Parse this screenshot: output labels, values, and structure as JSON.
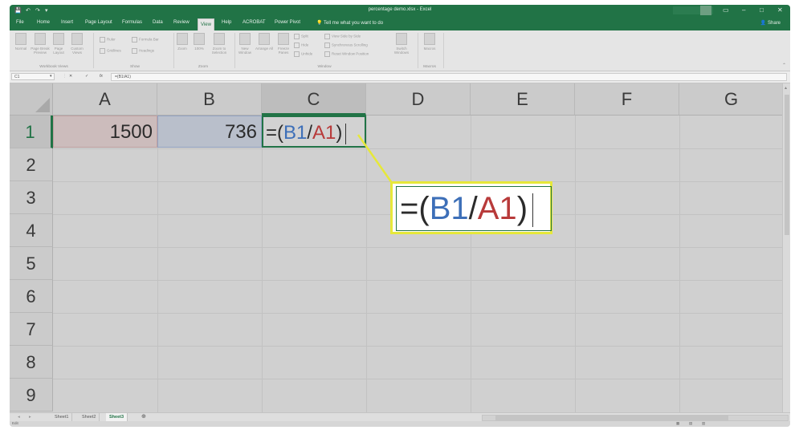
{
  "titlebar": {
    "doc_title": "percentage demo.xlsx - Excel",
    "minimize": "–",
    "restore": "□",
    "close": "✕",
    "quick_access": [
      "💾",
      "↶",
      "↷",
      "▾"
    ]
  },
  "tabs": {
    "items": [
      "File",
      "Home",
      "Insert",
      "Page Layout",
      "Formulas",
      "Data",
      "Review",
      "View",
      "Help",
      "ACROBAT",
      "Power Pivot"
    ],
    "active": "View",
    "tell_me": "Tell me what you want to do",
    "share": "Share"
  },
  "ribbon": {
    "groups": [
      {
        "label": "Workbook Views",
        "buttons": [
          "Normal",
          "Page Break Preview",
          "Page Layout",
          "Custom Views"
        ]
      },
      {
        "label": "Show",
        "checks": [
          "Ruler",
          "Formula Bar",
          "Gridlines",
          "Headings"
        ]
      },
      {
        "label": "Zoom",
        "buttons": [
          "Zoom",
          "100%",
          "Zoom to Selection"
        ]
      },
      {
        "label": "Window",
        "buttons": [
          "New Window",
          "Arrange All",
          "Freeze Panes"
        ],
        "small": [
          "Split",
          "Hide",
          "Unhide",
          "View Side by Side",
          "Synchronous Scrolling",
          "Reset Window Position"
        ],
        "switch": "Switch Windows"
      },
      {
        "label": "Macros",
        "buttons": [
          "Macros"
        ]
      }
    ]
  },
  "formula_bar": {
    "name_box": "C1",
    "formula": "=(B1/A1)",
    "fx": "fx",
    "cancel": "✕",
    "enter": "✓"
  },
  "grid": {
    "columns": [
      "A",
      "B",
      "C",
      "D",
      "E",
      "F",
      "G"
    ],
    "rows": [
      "1",
      "2",
      "3",
      "4",
      "5",
      "6",
      "7",
      "8",
      "9"
    ],
    "selected_column": "C",
    "selected_row": "1",
    "cells": {
      "A1": "1500",
      "B1": "736"
    },
    "formula_parts": {
      "prefix": "=(",
      "ref1": "B1",
      "slash": "/",
      "ref2": "A1",
      "suffix": ")"
    },
    "colors": {
      "ref1": "#3d6fb8",
      "ref2": "#b83a3a",
      "selection": "#217346",
      "callout_border": "#e6e83a"
    }
  },
  "sheets": {
    "tabs": [
      "Sheet1",
      "Sheet2",
      "Sheet3"
    ],
    "active": "Sheet3",
    "add": "⊕"
  },
  "status": {
    "mode": "Edit"
  }
}
